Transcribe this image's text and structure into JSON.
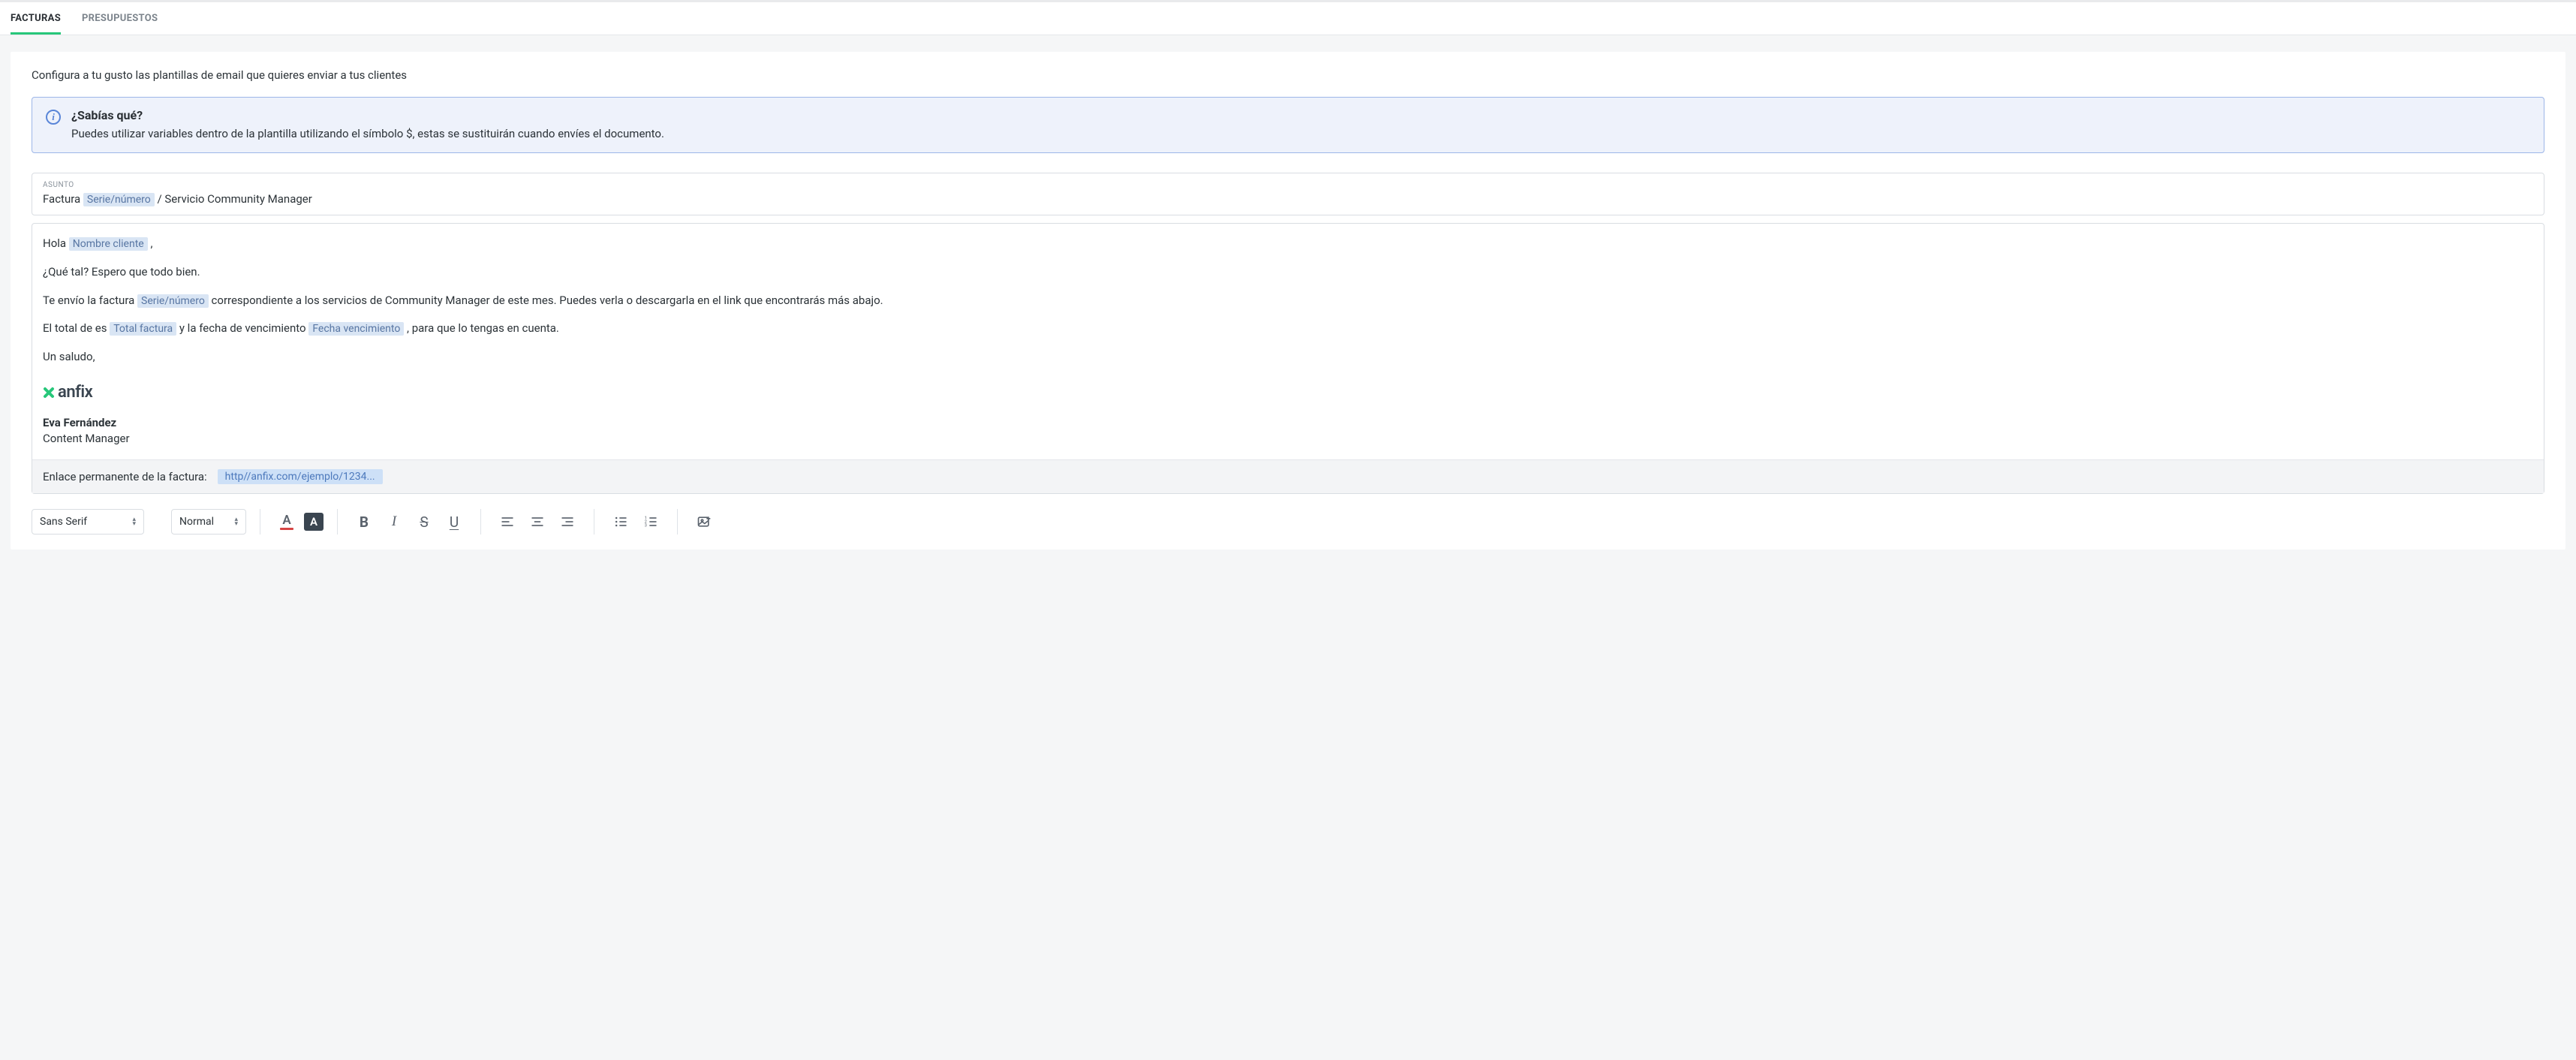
{
  "tabs": {
    "facturas": "FACTURAS",
    "presupuestos": "PRESUPUESTOS"
  },
  "intro": "Configura a tu gusto las plantillas de email que quieres enviar a tus clientes",
  "banner": {
    "title": "¿Sabías qué?",
    "text": "Puedes utilizar variables dentro de la plantilla utilizando el símbolo $, estas se sustituirán cuando envíes el documento."
  },
  "subject": {
    "label": "ASUNTO",
    "prefix": "Factura ",
    "var": "Serie/número",
    "suffix": "  / Servicio Community Manager"
  },
  "body": {
    "greeting_prefix": "Hola ",
    "greeting_var": "Nombre cliente",
    "greeting_suffix": " ,",
    "line2": "¿Qué tal? Espero que todo bien.",
    "line3_a": "Te envío la factura ",
    "line3_var": "Serie/número",
    "line3_b": "  correspondiente a los servicios de Community Manager de este mes.  Puedes verla o descargarla en el link  que encontrarás más abajo.",
    "line4_a": "El total de es ",
    "line4_var1": "Total factura",
    "line4_b": "  y la fecha de vencimiento ",
    "line4_var2": "Fecha vencimiento",
    "line4_c": " , para que lo tengas en cuenta.",
    "signoff": "Un saludo,"
  },
  "logo_text": "anfix",
  "signature": {
    "name": "Eva Fernández",
    "role": "Content Manager"
  },
  "permalink": {
    "label": "Enlace permanente de la factura:",
    "url": "http//anfix.com/ejemplo/1234..."
  },
  "toolbar": {
    "font": "Sans Serif",
    "size": "Normal"
  }
}
